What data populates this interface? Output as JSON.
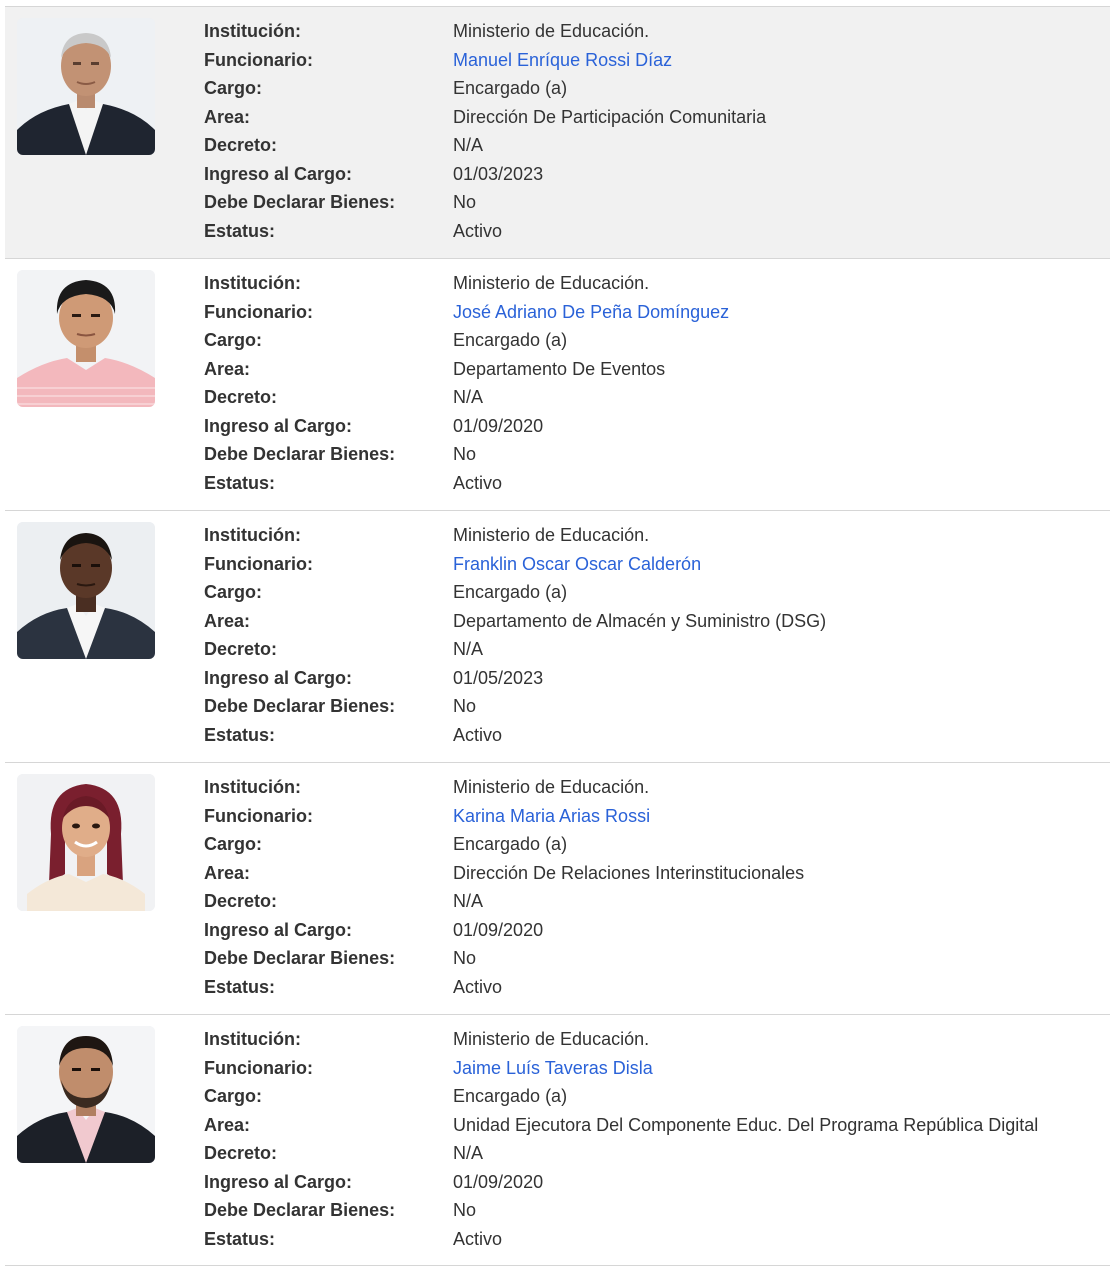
{
  "field_labels": {
    "institution": "Institución:",
    "official": "Funcionario:",
    "position": "Cargo:",
    "area": "Area:",
    "decree": "Decreto:",
    "start_date": "Ingreso al Cargo:",
    "must_declare": "Debe Declarar Bienes:",
    "status": "Estatus:"
  },
  "colors": {
    "link": "#2a62d8",
    "highlight_row": "#f1f1f1",
    "divider": "#d6d6d6"
  },
  "records": [
    {
      "institution": "Ministerio de Educación.",
      "official": "Manuel Enríque Rossi Díaz",
      "position": "Encargado (a)",
      "area": "Dirección De Participación Comunitaria",
      "decree": "N/A",
      "start_date": "01/03/2023",
      "must_declare": "No",
      "status": "Activo"
    },
    {
      "institution": "Ministerio de Educación.",
      "official": "José Adriano De Peña Domínguez",
      "position": "Encargado (a)",
      "area": "Departamento De Eventos",
      "decree": "N/A",
      "start_date": "01/09/2020",
      "must_declare": "No",
      "status": "Activo"
    },
    {
      "institution": "Ministerio de Educación.",
      "official": "Franklin Oscar Oscar Calderón",
      "position": "Encargado (a)",
      "area": "Departamento de Almacén y Suministro (DSG)",
      "decree": "N/A",
      "start_date": "01/05/2023",
      "must_declare": "No",
      "status": "Activo"
    },
    {
      "institution": "Ministerio de Educación.",
      "official": "Karina Maria Arias Rossi",
      "position": "Encargado (a)",
      "area": "Dirección De Relaciones Interinstitucionales",
      "decree": "N/A",
      "start_date": "01/09/2020",
      "must_declare": "No",
      "status": "Activo"
    },
    {
      "institution": "Ministerio de Educación.",
      "official": "Jaime Luís Taveras Disla",
      "position": "Encargado (a)",
      "area": "Unidad Ejecutora Del Componente Educ. Del Programa República Digital",
      "decree": "N/A",
      "start_date": "01/09/2020",
      "must_declare": "No",
      "status": "Activo"
    }
  ]
}
